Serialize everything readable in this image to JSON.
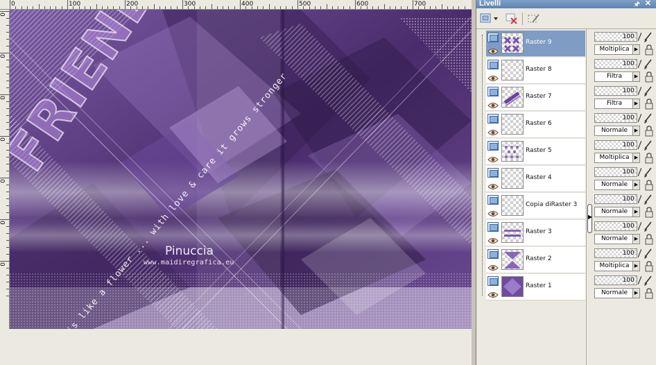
{
  "ruler": {
    "top_labels": [
      "0",
      "100",
      "200",
      "300",
      "400",
      "500",
      "600",
      "700"
    ],
    "left_labels": [
      "0",
      "0",
      "0",
      "0",
      "0",
      "0",
      "0"
    ]
  },
  "canvas": {
    "credit_name": "Pinuccia",
    "credit_url": "www.maidiregrafica.eu",
    "wordart_title": "FRIENDSHIP",
    "wordart_question": "?",
    "wordart_subtitle": "is like a flower ... with love & care it grows stronger"
  },
  "layers_panel": {
    "title": "Livelli",
    "toolbar": [
      "new-raster-layer",
      "delete-layer",
      "edit-selection"
    ],
    "layers": [
      {
        "name": "Raster 9",
        "opacity": "100",
        "blend": "Moltiplica",
        "selected": true,
        "thumb": "purple-cross"
      },
      {
        "name": "Raster 8",
        "opacity": "100",
        "blend": "Filtra",
        "selected": false,
        "thumb": "empty"
      },
      {
        "name": "Raster 7",
        "opacity": "100",
        "blend": "Filtra",
        "selected": false,
        "thumb": "text"
      },
      {
        "name": "Raster 6",
        "opacity": "100",
        "blend": "Normale",
        "selected": false,
        "thumb": "empty"
      },
      {
        "name": "Raster 5",
        "opacity": "100",
        "blend": "Moltiplica",
        "selected": false,
        "thumb": "dots"
      },
      {
        "name": "Raster 4",
        "opacity": "100",
        "blend": "Normale",
        "selected": false,
        "thumb": "empty"
      },
      {
        "name": "Copia diRaster 3",
        "opacity": "100",
        "blend": "Normale",
        "selected": false,
        "thumb": "empty"
      },
      {
        "name": "Raster 3",
        "opacity": "100",
        "blend": "Normale",
        "selected": false,
        "thumb": "bars"
      },
      {
        "name": "Raster 2",
        "opacity": "100",
        "blend": "Moltiplica",
        "selected": false,
        "thumb": "hourglass"
      },
      {
        "name": "Raster 1",
        "opacity": "100",
        "blend": "Normale",
        "selected": false,
        "thumb": "diamond"
      }
    ]
  },
  "colors": {
    "canvas_purple": "#5a3d7e",
    "selection_blue": "#7e9cc4",
    "title_bar": "#6a8cba"
  }
}
